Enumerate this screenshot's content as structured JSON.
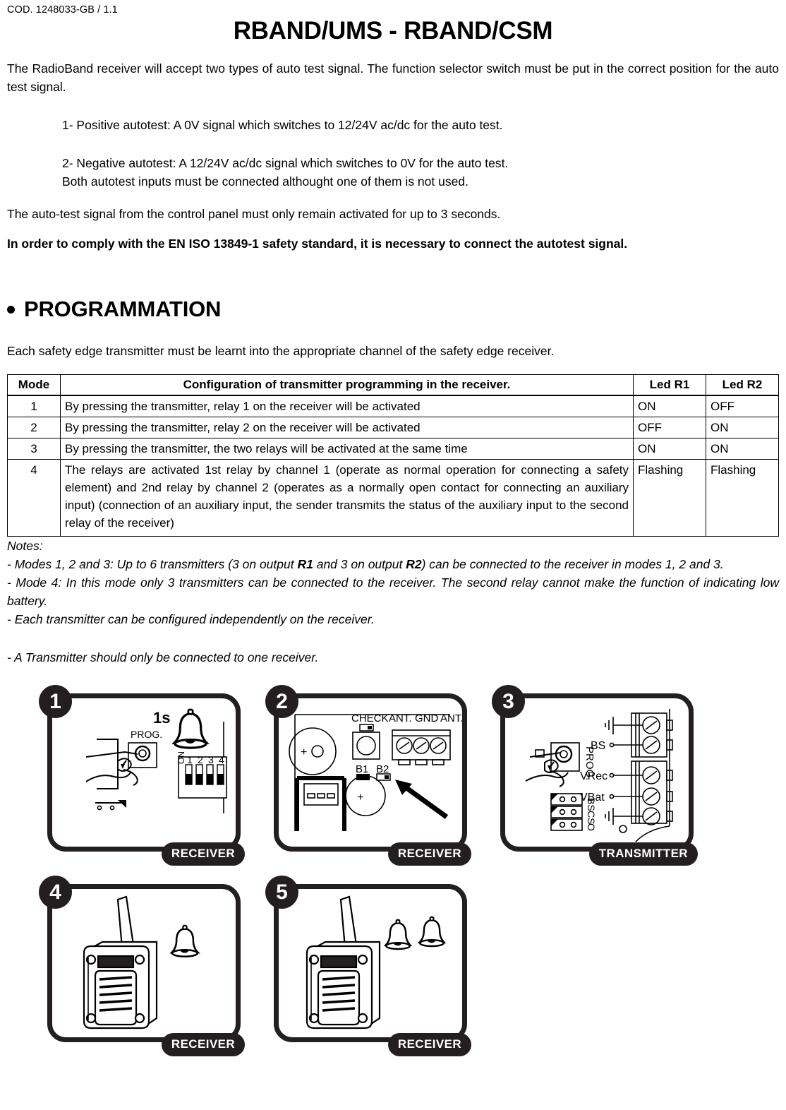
{
  "header": {
    "doc_code": "COD. 1248033-GB / 1.1",
    "title": "RBAND/UMS - RBAND/CSM"
  },
  "intro": {
    "paragraph_1": "The RadioBand receiver will accept two types of auto test signal. The function selector switch must be put in the correct position for the auto test signal.",
    "item_1": "1- Positive autotest: A 0V signal which switches to 12/24V ac/dc for the auto test.",
    "item_2_line1": "2- Negative autotest: A 12/24V ac/dc signal which switches to 0V for the auto test.",
    "item_2_line2": "Both autotest inputs must be connected althought one of them is not used.",
    "paragraph_2": "The auto-test signal from the control panel must only remain activated for up to 3 seconds.",
    "bold_statement": "In order to comply with the EN ISO 13849-1 safety standard, it is necessary to connect the autotest signal."
  },
  "programmation": {
    "heading": "PROGRAMMATION",
    "intro": "Each safety edge transmitter must be learnt into the appropriate channel of the safety edge receiver."
  },
  "table": {
    "headers": {
      "mode": "Mode",
      "configuration": "Configuration of transmitter programming in the receiver.",
      "led_r1": "Led R1",
      "led_r2": "Led R2"
    },
    "rows": [
      {
        "mode": "1",
        "configuration": "By pressing the transmitter, relay 1 on the receiver will be activated",
        "led_r1": "ON",
        "led_r2": "OFF"
      },
      {
        "mode": "2",
        "configuration": "By pressing the transmitter, relay 2 on the receiver will be activated",
        "led_r1": "OFF",
        "led_r2": "ON"
      },
      {
        "mode": "3",
        "configuration": "By pressing the transmitter, the two relays will be activated at the same time",
        "led_r1": "ON",
        "led_r2": "ON"
      },
      {
        "mode": "4",
        "configuration": "The relays are activated 1st relay by channel 1 (operate as normal operation for connecting a safety element) and 2nd relay by channel 2 (operates as a normally open contact for connecting an auxiliary input) (connection of an auxiliary input, the sender transmits the status of the auxiliary input to the second relay of the receiver)",
        "led_r1": "Flashing",
        "led_r2": "Flashing"
      }
    ]
  },
  "notes": {
    "label": "Notes:",
    "note_1_part1": "- Modes 1, 2 and 3: Up to 6 transmitters (3 on output ",
    "note_1_r1": "R1",
    "note_1_part2": " and 3 on output ",
    "note_1_r2": "R2",
    "note_1_part3": ") can be connected to the receiver in modes 1, 2 and 3.",
    "note_2": "- Mode 4:  In this mode only 3 transmitters can be connected to the receiver. The second relay cannot make the function of indicating low battery.",
    "note_3": "- Each transmitter can be configured independently on the receiver.",
    "note_4": "- A Transmitter should only be connected to one receiver."
  },
  "diagrams": {
    "panels": [
      {
        "number": "1",
        "tag": "RECEIVER",
        "labels": {
          "prog": "PROG.",
          "duration": "1s",
          "dip_on": "ON",
          "dip_1": "1",
          "dip_2": "2",
          "dip_3": "3",
          "dip_4": "4"
        }
      },
      {
        "number": "2",
        "tag": "RECEIVER",
        "labels": {
          "check": "CHECK",
          "ant_left": "ANT.",
          "gnd": "GND",
          "ant_right": "ANT.",
          "b1": "B1",
          "b2": "B2",
          "plus_top": "+",
          "plus_bottom": "+"
        }
      },
      {
        "number": "3",
        "tag": "TRANSMITTER",
        "labels": {
          "prog": "PROG.",
          "bs": "BS",
          "vrec": "VRec",
          "vbat": "VBat",
          "jumper_bs": "BS",
          "jumper_cs": "CS",
          "jumper_o": "O"
        }
      },
      {
        "number": "4",
        "tag": "RECEIVER",
        "labels": {
          "bells": "1"
        }
      },
      {
        "number": "5",
        "tag": "RECEIVER",
        "labels": {
          "bells": "2"
        }
      }
    ]
  }
}
